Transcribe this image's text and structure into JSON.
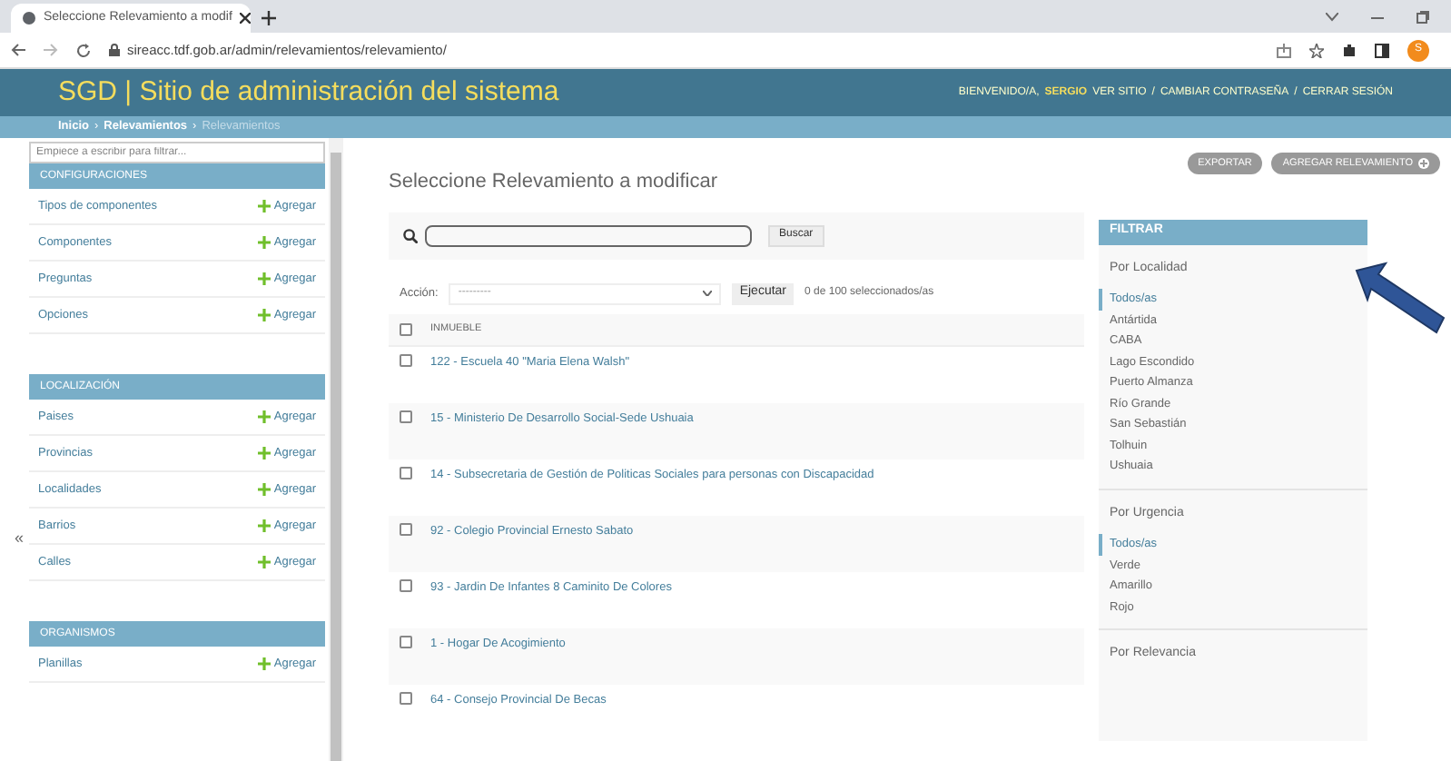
{
  "browser": {
    "tab_title": "Seleccione Relevamiento a modif",
    "url": "sireacc.tdf.gob.ar/admin/relevamientos/relevamiento/",
    "avatar": "S"
  },
  "header": {
    "title": "SGD | Sitio de administración del sistema",
    "welcome": "BIENVENIDO/A,",
    "user": "SERGIO",
    "links": [
      "VER SITIO",
      "CAMBIAR CONTRASEÑA",
      "CERRAR SESIÓN"
    ],
    "link_separator": "/"
  },
  "breadcrumbs": [
    "Inicio",
    "Relevamientos",
    "Relevamientos"
  ],
  "breadcrumb_separator": "›",
  "nav_filter": {
    "placeholder": "Empiece a escribir para filtrar..."
  },
  "collapse_toggle": "«",
  "sidebar": [
    {
      "title": "CONFIGURACIONES",
      "items": [
        {
          "label": "Tipos de componentes",
          "add": "Agregar"
        },
        {
          "label": "Componentes",
          "add": "Agregar"
        },
        {
          "label": "Preguntas",
          "add": "Agregar"
        },
        {
          "label": "Opciones",
          "add": "Agregar"
        }
      ]
    },
    {
      "title": "LOCALIZACIÓN",
      "items": [
        {
          "label": "Paises",
          "add": "Agregar"
        },
        {
          "label": "Provincias",
          "add": "Agregar"
        },
        {
          "label": "Localidades",
          "add": "Agregar"
        },
        {
          "label": "Barrios",
          "add": "Agregar"
        },
        {
          "label": "Calles",
          "add": "Agregar"
        }
      ]
    },
    {
      "title": "ORGANISMOS",
      "items": [
        {
          "label": "Planillas",
          "add": "Agregar"
        }
      ]
    }
  ],
  "main": {
    "title": "Seleccione Relevamiento a modificar",
    "buttons": [
      "EXPORTAR",
      "AGREGAR RELEVAMIENTO"
    ],
    "search_button": "Buscar",
    "action_label": "Acción:",
    "action_value": "---------",
    "run_button": "Ejecutar",
    "selection_count": "0 de 100 seleccionados/as",
    "column": "INMUEBLE",
    "select_all_checked": false,
    "rows": [
      {
        "text": "122 - Escuela 40 \"Maria Elena Walsh\"",
        "checked": false
      },
      {
        "text": "15 - Ministerio De Desarrollo Social-Sede Ushuaia",
        "checked": false
      },
      {
        "text": "14 - Subsecretaria de Gestión de Politicas Sociales para personas con Discapacidad",
        "checked": false
      },
      {
        "text": "92 - Colegio Provincial Ernesto Sabato",
        "checked": false
      },
      {
        "text": "93 - Jardin De Infantes 8 Caminito De Colores",
        "checked": false
      },
      {
        "text": "1 - Hogar De Acogimiento",
        "checked": false
      },
      {
        "text": "64 - Consejo Provincial De Becas",
        "checked": false
      }
    ]
  },
  "filter": {
    "title": "FILTRAR",
    "groups": [
      {
        "title": "Por Localidad",
        "options": [
          {
            "label": "Todos/as",
            "selected": true
          },
          {
            "label": "Antártida",
            "selected": false
          },
          {
            "label": "CABA",
            "selected": false
          },
          {
            "label": "Lago Escondido",
            "selected": false
          },
          {
            "label": "Puerto Almanza",
            "selected": false
          },
          {
            "label": "Río Grande",
            "selected": false
          },
          {
            "label": "San Sebastián",
            "selected": false
          },
          {
            "label": "Tolhuin",
            "selected": false
          },
          {
            "label": "Ushuaia",
            "selected": false
          }
        ]
      },
      {
        "title": "Por Urgencia",
        "options": [
          {
            "label": "Todos/as",
            "selected": true
          },
          {
            "label": "Verde",
            "selected": false
          },
          {
            "label": "Amarillo",
            "selected": false
          },
          {
            "label": "Rojo",
            "selected": false
          }
        ]
      },
      {
        "title": "Por Relevancia"
      }
    ]
  }
}
